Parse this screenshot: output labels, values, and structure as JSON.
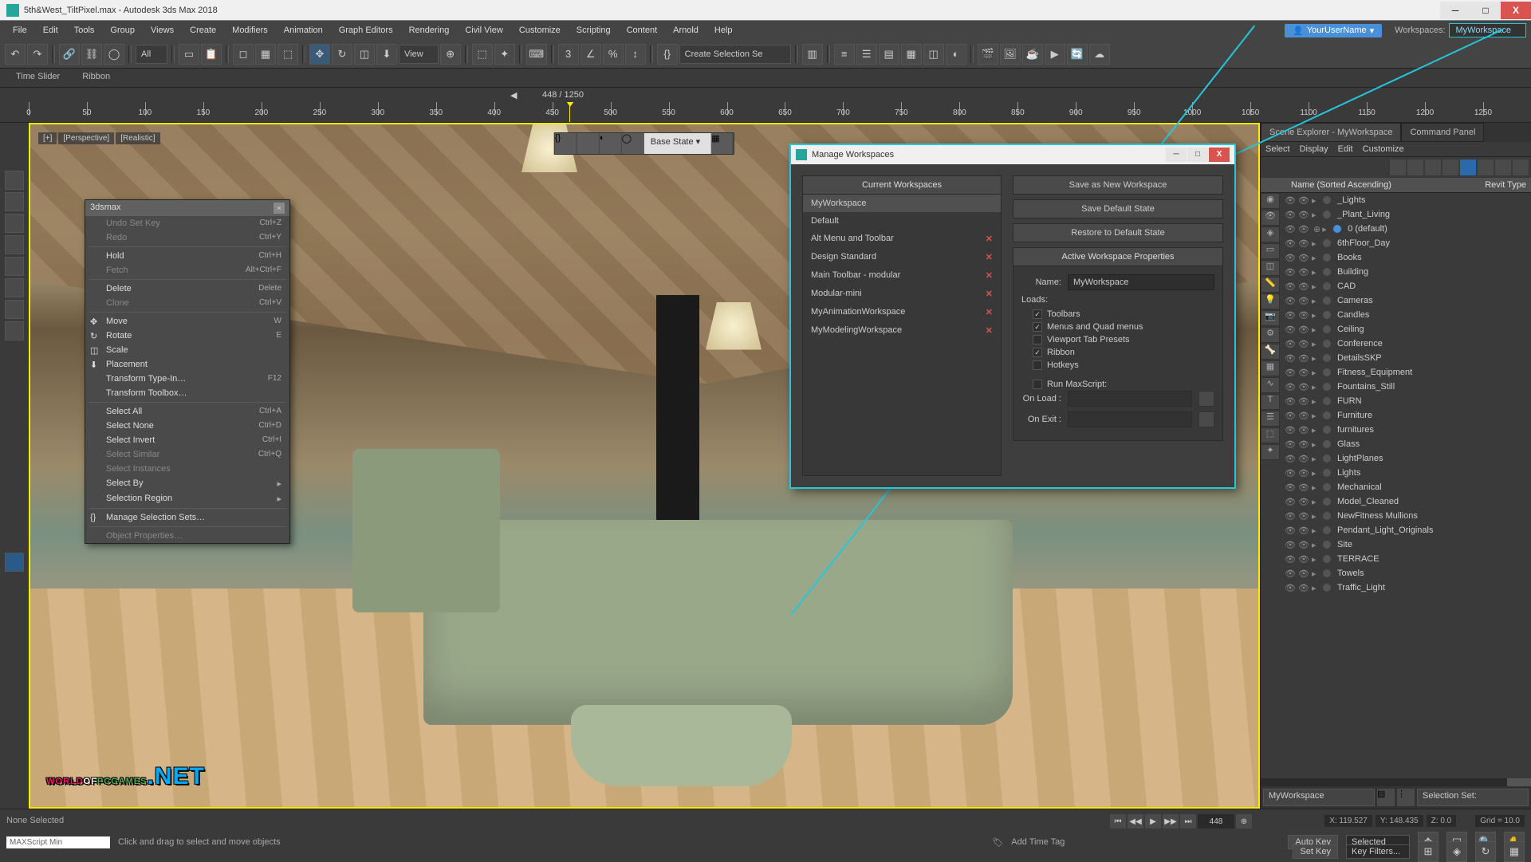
{
  "window": {
    "title": "5th&West_TiltPixel.max - Autodesk 3ds Max 2018",
    "min": "─",
    "max": "□",
    "close": "X"
  },
  "menubar": {
    "items": [
      "File",
      "Edit",
      "Tools",
      "Group",
      "Views",
      "Create",
      "Modifiers",
      "Animation",
      "Graph Editors",
      "Rendering",
      "Civil View",
      "Customize",
      "Scripting",
      "Content",
      "Arnold",
      "Help"
    ],
    "user": "YourUserName",
    "wslabel": "Workspaces:",
    "wsvalue": "MyWorkspace"
  },
  "toolbar": {
    "alldrop": "All",
    "viewdrop": "View",
    "seldrop": "Create Selection Se"
  },
  "ribbon": {
    "tabs": [
      "Time Slider",
      "Ribbon"
    ]
  },
  "frame": {
    "text": "448 / 1250"
  },
  "ruler": {
    "ticks": [
      0,
      50,
      100,
      150,
      200,
      250,
      300,
      350,
      400,
      450,
      500,
      550,
      600,
      650,
      700,
      750,
      800,
      850,
      900,
      950,
      1000,
      1050,
      1100,
      1150,
      1200,
      1250
    ]
  },
  "viewport": {
    "basestate": "Base State",
    "watermark": {
      "a": "WORLD",
      "b": "OF",
      "c": "PCGAMES",
      "d": ".NET"
    }
  },
  "ctx": {
    "title": "3dsmax",
    "items": [
      {
        "t": "Undo Set Key",
        "sc": "Ctrl+Z",
        "dis": true
      },
      {
        "t": "Redo",
        "sc": "Ctrl+Y",
        "dis": true
      },
      {
        "sep": true
      },
      {
        "t": "Hold",
        "sc": "Ctrl+H"
      },
      {
        "t": "Fetch",
        "sc": "Alt+Ctrl+F",
        "dis": true
      },
      {
        "sep": true
      },
      {
        "t": "Delete",
        "sc": "Delete"
      },
      {
        "t": "Clone",
        "sc": "Ctrl+V",
        "dis": true
      },
      {
        "sep": true
      },
      {
        "t": "Move",
        "sc": "W",
        "ic": "✥"
      },
      {
        "t": "Rotate",
        "sc": "E",
        "ic": "↻"
      },
      {
        "t": "Scale",
        "ic": "◫"
      },
      {
        "t": "Placement",
        "ic": "⬇"
      },
      {
        "t": "Transform Type-In…",
        "sc": "F12"
      },
      {
        "t": "Transform Toolbox…"
      },
      {
        "sep": true
      },
      {
        "t": "Select All",
        "sc": "Ctrl+A"
      },
      {
        "t": "Select None",
        "sc": "Ctrl+D"
      },
      {
        "t": "Select Invert",
        "sc": "Ctrl+I"
      },
      {
        "t": "Select Similar",
        "sc": "Ctrl+Q",
        "dis": true
      },
      {
        "t": "Select Instances",
        "dis": true
      },
      {
        "t": "Select By",
        "sub": "▸"
      },
      {
        "t": "Selection Region",
        "sub": "▸"
      },
      {
        "sep": true
      },
      {
        "t": "Manage Selection Sets…",
        "ic": "{}"
      },
      {
        "sep": true
      },
      {
        "t": "Object Properties…",
        "dis": true
      }
    ]
  },
  "dialog": {
    "title": "Manage Workspaces",
    "list_title": "Current Workspaces",
    "items": [
      {
        "n": "MyWorkspace",
        "sel": true
      },
      {
        "n": "Default"
      },
      {
        "n": "Alt Menu and Toolbar",
        "del": true
      },
      {
        "n": "Design Standard",
        "del": true
      },
      {
        "n": "Main Toolbar - modular",
        "del": true
      },
      {
        "n": "Modular-mini",
        "del": true
      },
      {
        "n": "MyAnimationWorkspace",
        "del": true
      },
      {
        "n": "MyModelingWorkspace",
        "del": true
      }
    ],
    "btn_savenew": "Save as New Workspace",
    "btn_savedef": "Save Default State",
    "btn_restore": "Restore to Default State",
    "props_title": "Active Workspace Properties",
    "name_lbl": "Name:",
    "name_val": "MyWorkspace",
    "loads_lbl": "Loads:",
    "checks": [
      {
        "t": "Toolbars",
        "c": true
      },
      {
        "t": "Menus and Quad menus",
        "c": true
      },
      {
        "t": "Viewport Tab Presets",
        "c": false
      },
      {
        "t": "Ribbon",
        "c": true
      },
      {
        "t": "Hotkeys",
        "c": false
      }
    ],
    "runms": "Run MaxScript:",
    "onload": "On Load :",
    "onexit": "On Exit :"
  },
  "explorer": {
    "tab1": "Scene Explorer - MyWorkspace",
    "tab2": "Command Panel",
    "cols": [
      "Select",
      "Display",
      "Edit",
      "Customize"
    ],
    "header": {
      "name": "Name (Sorted Ascending)",
      "col2": "Revit Type"
    },
    "items": [
      "_Lights",
      "_Plant_Living",
      "0 (default)",
      "6thFloor_Day",
      "Books",
      "Building",
      "CAD",
      "Cameras",
      "Candles",
      "Ceiling",
      "Conference",
      "DetailsSKP",
      "Fitness_Equipment",
      "Fountains_Still",
      "FURN",
      "Furniture",
      "furnitures",
      "Glass",
      "LightPlanes",
      "Lights",
      "Mechanical",
      "Model_Cleaned",
      "NewFitness Mullions",
      "Pendant_Light_Originals",
      "Site",
      "TERRACE",
      "Towels",
      "Traffic_Light"
    ],
    "footdrop": "MyWorkspace",
    "selset": "Selection Set:"
  },
  "status": {
    "none": "None Selected",
    "hint": "Click and drag to select and move objects",
    "msbox": "MAXScript Min",
    "x": "X: 119.527",
    "y": "Y: 148.435",
    "z": "Z: 0.0",
    "grid": "Grid = 10.0",
    "frame": "448",
    "addtag": "Add Time Tag",
    "autokey": "Auto Key",
    "setkey": "Set Key",
    "selected": "Selected",
    "keyfilt": "Key Filters..."
  }
}
